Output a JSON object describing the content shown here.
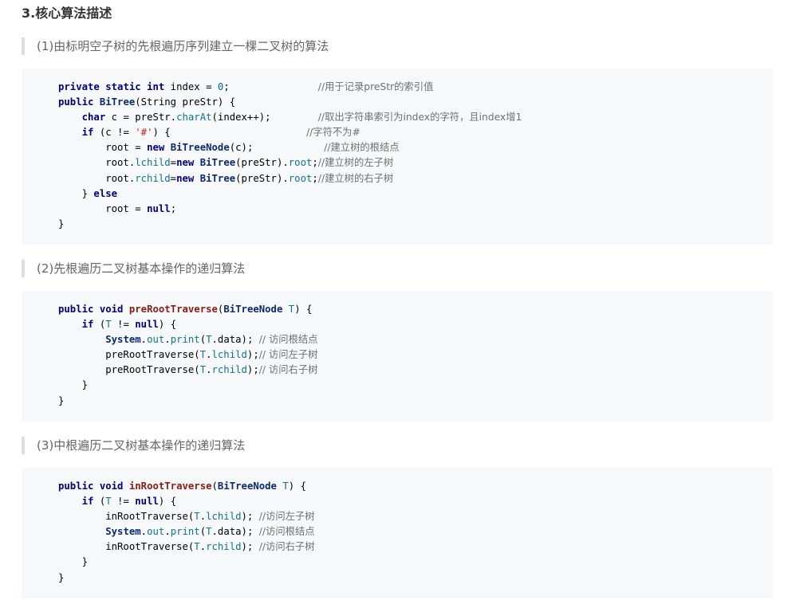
{
  "section_title": "3.核心算法描述",
  "subsections": [
    {
      "title": "(1)由标明空子树的先根遍历序列建立一棵二叉树的算法"
    },
    {
      "title": "(2)先根遍历二叉树基本操作的递归算法"
    },
    {
      "title": "(3)中根遍历二叉树基本操作的递归算法"
    }
  ],
  "code_blocks": [
    {
      "lines": [
        [
          [
            "kw",
            "private"
          ],
          [
            "p",
            " "
          ],
          [
            "kw",
            "static"
          ],
          [
            "p",
            " "
          ],
          [
            "kw",
            "int"
          ],
          [
            "p",
            " index = "
          ],
          [
            "num",
            "0"
          ],
          [
            "p",
            ";               "
          ],
          [
            "cm",
            "//用于记录preStr的索引值"
          ]
        ],
        [
          [
            "kw",
            "public"
          ],
          [
            "p",
            " "
          ],
          [
            "cls",
            "BiTree"
          ],
          [
            "p",
            "(String preStr) {"
          ]
        ],
        [
          [
            "p",
            "    "
          ],
          [
            "kw",
            "char"
          ],
          [
            "p",
            " c = preStr."
          ],
          [
            "field",
            "charAt"
          ],
          [
            "p",
            "(index++);        "
          ],
          [
            "cm",
            "//取出字符串索引为index的字符，且index增1"
          ]
        ],
        [
          [
            "p",
            "    "
          ],
          [
            "kw",
            "if"
          ],
          [
            "p",
            " (c != "
          ],
          [
            "str",
            "'#'"
          ],
          [
            "p",
            ") {                       "
          ],
          [
            "cm",
            "//字符不为#"
          ]
        ],
        [
          [
            "p",
            "        root = "
          ],
          [
            "kw",
            "new"
          ],
          [
            "p",
            " "
          ],
          [
            "cls",
            "BiTreeNode"
          ],
          [
            "p",
            "(c);            "
          ],
          [
            "cm",
            "//建立树的根结点"
          ]
        ],
        [
          [
            "p",
            "        root."
          ],
          [
            "field",
            "lchild"
          ],
          [
            "p",
            "="
          ],
          [
            "kw",
            "new"
          ],
          [
            "p",
            " "
          ],
          [
            "cls",
            "BiTree"
          ],
          [
            "p",
            "(preStr)."
          ],
          [
            "field",
            "root"
          ],
          [
            "p",
            ";"
          ],
          [
            "cm",
            "//建立树的左子树"
          ]
        ],
        [
          [
            "p",
            "        root."
          ],
          [
            "field",
            "rchild"
          ],
          [
            "p",
            "="
          ],
          [
            "kw",
            "new"
          ],
          [
            "p",
            " "
          ],
          [
            "cls",
            "BiTree"
          ],
          [
            "p",
            "(preStr)."
          ],
          [
            "field",
            "root"
          ],
          [
            "p",
            ";"
          ],
          [
            "cm",
            "//建立树的右子树"
          ]
        ],
        [
          [
            "p",
            "    } "
          ],
          [
            "kw",
            "else"
          ]
        ],
        [
          [
            "p",
            "        root = "
          ],
          [
            "kw",
            "null"
          ],
          [
            "p",
            ";"
          ]
        ],
        [
          [
            "p",
            "}"
          ]
        ]
      ]
    },
    {
      "lines": [
        [
          [
            "kw",
            "public"
          ],
          [
            "p",
            " "
          ],
          [
            "kw",
            "void"
          ],
          [
            "p",
            " "
          ],
          [
            "fn",
            "preRootTraverse"
          ],
          [
            "p",
            "("
          ],
          [
            "cls",
            "BiTreeNode"
          ],
          [
            "p",
            " "
          ],
          [
            "field",
            "T"
          ],
          [
            "p",
            ") {"
          ]
        ],
        [
          [
            "p",
            "    "
          ],
          [
            "kw",
            "if"
          ],
          [
            "p",
            " ("
          ],
          [
            "field",
            "T"
          ],
          [
            "p",
            " != "
          ],
          [
            "kw",
            "null"
          ],
          [
            "p",
            ") {"
          ]
        ],
        [
          [
            "p",
            "        "
          ],
          [
            "cls",
            "System"
          ],
          [
            "p",
            "."
          ],
          [
            "field",
            "out"
          ],
          [
            "p",
            "."
          ],
          [
            "field",
            "print"
          ],
          [
            "p",
            "("
          ],
          [
            "field",
            "T"
          ],
          [
            "p",
            ".data); "
          ],
          [
            "cm",
            "// 访问根结点"
          ]
        ],
        [
          [
            "p",
            "        preRootTraverse("
          ],
          [
            "field",
            "T"
          ],
          [
            "p",
            "."
          ],
          [
            "field",
            "lchild"
          ],
          [
            "p",
            ");"
          ],
          [
            "cm",
            "// 访问左子树"
          ]
        ],
        [
          [
            "p",
            "        preRootTraverse("
          ],
          [
            "field",
            "T"
          ],
          [
            "p",
            "."
          ],
          [
            "field",
            "rchild"
          ],
          [
            "p",
            ");"
          ],
          [
            "cm",
            "// 访问右子树"
          ]
        ],
        [
          [
            "p",
            "    }"
          ]
        ],
        [
          [
            "p",
            "}"
          ]
        ]
      ]
    },
    {
      "lines": [
        [
          [
            "kw",
            "public"
          ],
          [
            "p",
            " "
          ],
          [
            "kw",
            "void"
          ],
          [
            "p",
            " "
          ],
          [
            "fn",
            "inRootTraverse"
          ],
          [
            "p",
            "("
          ],
          [
            "cls",
            "BiTreeNode"
          ],
          [
            "p",
            " "
          ],
          [
            "field",
            "T"
          ],
          [
            "p",
            ") {"
          ]
        ],
        [
          [
            "p",
            "    "
          ],
          [
            "kw",
            "if"
          ],
          [
            "p",
            " ("
          ],
          [
            "field",
            "T"
          ],
          [
            "p",
            " != "
          ],
          [
            "kw",
            "null"
          ],
          [
            "p",
            ") {"
          ]
        ],
        [
          [
            "p",
            "        inRootTraverse("
          ],
          [
            "field",
            "T"
          ],
          [
            "p",
            "."
          ],
          [
            "field",
            "lchild"
          ],
          [
            "p",
            "); "
          ],
          [
            "cm",
            "//访问左子树"
          ]
        ],
        [
          [
            "p",
            "        "
          ],
          [
            "cls",
            "System"
          ],
          [
            "p",
            "."
          ],
          [
            "field",
            "out"
          ],
          [
            "p",
            "."
          ],
          [
            "field",
            "print"
          ],
          [
            "p",
            "("
          ],
          [
            "field",
            "T"
          ],
          [
            "p",
            ".data); "
          ],
          [
            "cm",
            "//访问根结点"
          ]
        ],
        [
          [
            "p",
            "        inRootTraverse("
          ],
          [
            "field",
            "T"
          ],
          [
            "p",
            "."
          ],
          [
            "field",
            "rchild"
          ],
          [
            "p",
            "); "
          ],
          [
            "cm",
            "//访问右子树"
          ]
        ],
        [
          [
            "p",
            "    }"
          ]
        ],
        [
          [
            "p",
            "}"
          ]
        ]
      ]
    }
  ]
}
